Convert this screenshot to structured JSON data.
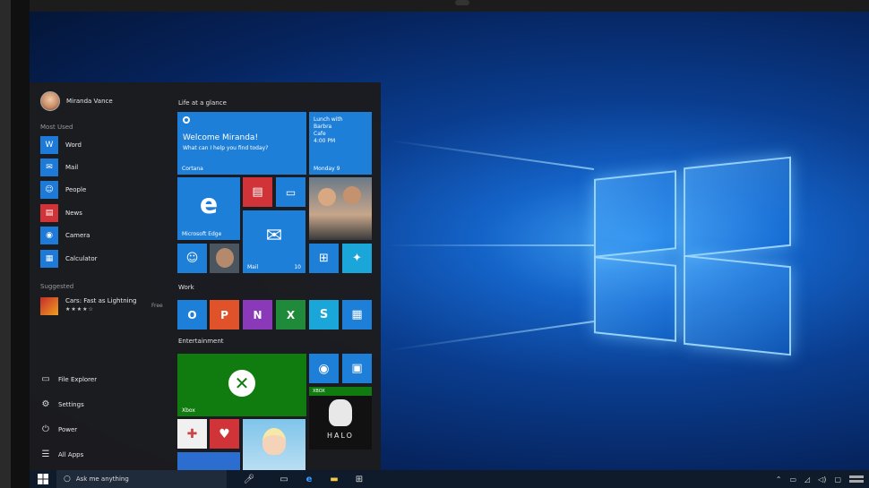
{
  "user": {
    "name": "Miranda Vance"
  },
  "most_used": {
    "heading": "Most Used",
    "items": [
      {
        "label": "Word",
        "icon": "word-icon",
        "glyph": "W"
      },
      {
        "label": "Mail",
        "icon": "mail-icon",
        "glyph": "✉"
      },
      {
        "label": "People",
        "icon": "people-icon",
        "glyph": "☺"
      },
      {
        "label": "News",
        "icon": "news-icon",
        "glyph": "▤"
      },
      {
        "label": "Camera",
        "icon": "camera-icon",
        "glyph": "◉"
      },
      {
        "label": "Calculator",
        "icon": "calculator-icon",
        "glyph": "▦"
      }
    ]
  },
  "suggested": {
    "heading": "Suggested",
    "app": "Cars: Fast as Lightning",
    "rating": "★★★★☆",
    "price": "Free"
  },
  "bottom_items": [
    {
      "label": "File Explorer",
      "icon": "folder-icon",
      "glyph": "▭"
    },
    {
      "label": "Settings",
      "icon": "gear-icon",
      "glyph": "⚙"
    },
    {
      "label": "Power",
      "icon": "power-icon",
      "glyph": "⏻"
    },
    {
      "label": "All Apps",
      "icon": "all-apps-icon",
      "glyph": "☰"
    }
  ],
  "groups": {
    "life": "Life at a glance",
    "work": "Work",
    "entertainment": "Entertainment"
  },
  "tiles": {
    "cortana": {
      "title": "Welcome Miranda!",
      "subtitle": "What can I help you find today?",
      "label": "Cortana"
    },
    "calendar": {
      "line1": "Lunch with",
      "line2": "Barbra",
      "line3": "Cafe",
      "line4": "4:00 PM",
      "label": "Monday 9"
    },
    "edge": {
      "label": "Microsoft Edge"
    },
    "mail": {
      "label": "Mail",
      "count": "10"
    },
    "xbox": {
      "label": "Xbox"
    },
    "xbox_badge": "XBOX",
    "halo": "HALO"
  },
  "taskbar": {
    "search_placeholder": "Ask me anything"
  },
  "colors": {
    "tile_blue": "#1e7fd9",
    "xbox_green": "#107c10",
    "start_bg": "#1c1c1e"
  }
}
